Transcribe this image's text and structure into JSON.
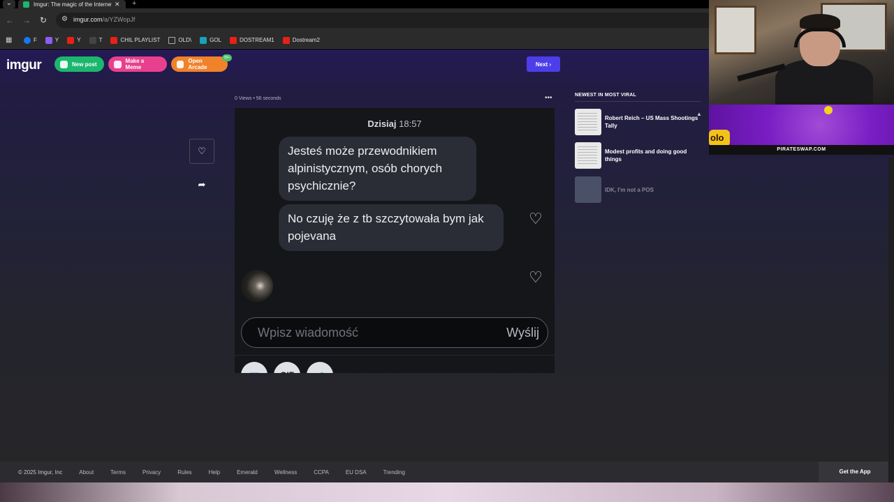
{
  "browser": {
    "tab_title": "Imgur: The magic of the Internet",
    "tab_close": "✕",
    "new_tab": "+",
    "url_host": "imgur.com",
    "url_path": "/a/YZWopJf",
    "bookmarks": [
      {
        "label": "F",
        "color": "#1877f2"
      },
      {
        "label": "Y",
        "color": "#8b5cf6"
      },
      {
        "label": "Y",
        "color": "#e62117"
      },
      {
        "label": "T",
        "color": "#444444"
      },
      {
        "label": "CHIL PLAYLIST",
        "color": "#e62117"
      },
      {
        "label": "OLD\\",
        "color": "#aaaaaa"
      },
      {
        "label": "GOL",
        "color": "#17a2b8"
      },
      {
        "label": "DOSTREAM1",
        "color": "#e62117"
      },
      {
        "label": "Dostream2",
        "color": "#e62117"
      }
    ]
  },
  "header": {
    "logo": "imgur",
    "new_post": "New post",
    "make_meme": "Make a Meme",
    "open_arcade": "Open Arcade",
    "arcade_badge": "20+",
    "next": "Next"
  },
  "post": {
    "meta": "0 Views • 56 seconds",
    "more": "•••",
    "chat": {
      "date_day": "Dzisiaj",
      "date_time": "18:57",
      "message1": "Jesteś może przewodnikiem alpinistycznym, osób chorych psychicznie?",
      "message2": "No czuję że z tb szczytowała bym jak pojevana",
      "input_placeholder": "Wpisz wiadomość",
      "send": "Wyślij",
      "gif": "GIF"
    }
  },
  "sidebar": {
    "heading": "NEWEST IN MOST VIRAL",
    "items": [
      {
        "title": "Robert Reich – US Mass Shootings Tally"
      },
      {
        "title": "Modest profits and doing good things"
      },
      {
        "title": "IDK, I'm not a POS"
      }
    ]
  },
  "footer": {
    "copyright": "© 2025 Imgur, Inc",
    "links": [
      "About",
      "Terms",
      "Privacy",
      "Rules",
      "Help",
      "Emerald",
      "Wellness",
      "CCPA",
      "EU DSA",
      "Trending"
    ],
    "get_app": "Get the App"
  },
  "overlay": {
    "banner_text": "PIRATESWAP.COM",
    "banner_logo_text": "olo"
  },
  "colors": {
    "accent_green": "#1bb76e",
    "accent_pink": "#e8408e",
    "accent_orange": "#f0822a",
    "next_blue": "#4c3ee8"
  }
}
